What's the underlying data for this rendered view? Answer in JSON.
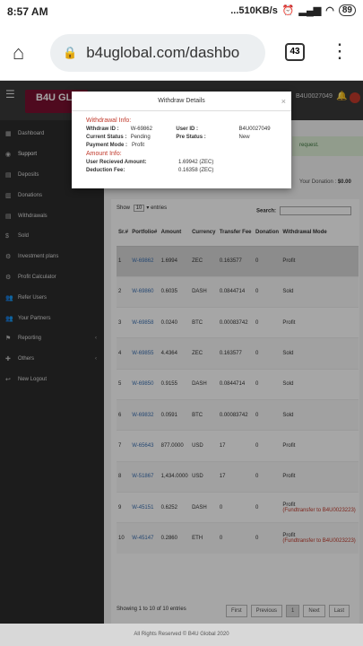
{
  "status": {
    "time": "8:57 AM",
    "speed": "...510KB/s",
    "battery": "89"
  },
  "browser": {
    "url": "b4uglobal.com/dashbo",
    "tabs": "43"
  },
  "brand": {
    "logo": "B4U GL",
    "user": "B4U0027049"
  },
  "sidebar": [
    "Dashboard",
    "Support",
    "Deposits",
    "Donations",
    "Withdrawals",
    "Sold",
    "Investment plans",
    "Profit Calculator",
    "Refer Users",
    "Your Partners",
    "Reporting",
    "Others",
    "New Logout"
  ],
  "sidebar_icons": [
    "dashboard-icon",
    "support-icon",
    "deposits-icon",
    "donations-icon",
    "withdrawals-icon",
    "sold-icon",
    "plans-icon",
    "calculator-icon",
    "refer-icon",
    "partners-icon",
    "reporting-icon",
    "others-icon",
    "logout-icon"
  ],
  "alert": "request.",
  "donation": {
    "label": "Your Donation :",
    "value": "$0.00"
  },
  "table": {
    "show_pre": "Show",
    "show_val": "10",
    "show_post": "entries",
    "search": "Search:",
    "headers": [
      "Sr.#",
      "Portfolio#",
      "Amount",
      "Currency",
      "Transfer Fee",
      "Donation",
      "Withdrawal Mode"
    ],
    "rows": [
      [
        "1",
        "W-69862",
        "1.6994",
        "ZEC",
        "0.163577",
        "0",
        "Profit",
        ""
      ],
      [
        "2",
        "W-69860",
        "0.6035",
        "DASH",
        "0.0844714",
        "0",
        "Sold",
        ""
      ],
      [
        "3",
        "W-69858",
        "0.0240",
        "BTC",
        "0.00083742",
        "0",
        "Profit",
        ""
      ],
      [
        "4",
        "W-69855",
        "4.4364",
        "ZEC",
        "0.163577",
        "0",
        "Sold",
        ""
      ],
      [
        "5",
        "W-69850",
        "0.9155",
        "DASH",
        "0.0844714",
        "0",
        "Sold",
        ""
      ],
      [
        "6",
        "W-69832",
        "0.0591",
        "BTC",
        "0.00083742",
        "0",
        "Sold",
        ""
      ],
      [
        "7",
        "W-65643",
        "877.0000",
        "USD",
        "17",
        "0",
        "Profit",
        ""
      ],
      [
        "8",
        "W-51867",
        "1,434.0000",
        "USD",
        "17",
        "0",
        "Profit",
        ""
      ],
      [
        "9",
        "W-45151",
        "0.6252",
        "DASH",
        "0",
        "0",
        "Profit",
        "(Fundtransfer to B4U0023223)"
      ],
      [
        "10",
        "W-45147",
        "0.2860",
        "ETH",
        "0",
        "0",
        "Profit",
        "(Fundtransfer to B4U0023223)"
      ]
    ],
    "footer": "Showing 1 to 10 of 10 entries",
    "pager": [
      "First",
      "Previous",
      "1",
      "Next",
      "Last"
    ]
  },
  "copyright": "All Rights Reserved © B4U Global 2020",
  "modal": {
    "title": "Withdraw Details",
    "close": "×",
    "sec1": "Withdrawal Info:",
    "wid_l": "Wthdraw ID :",
    "wid_v": "W-69862",
    "uid_l": "User ID :",
    "uid_v": "B4U0027049",
    "cs_l": "Current Status :",
    "cs_v": "Pending",
    "ps_l": "Pre Status :",
    "ps_v": "New",
    "pm_l": "Payment Mode :",
    "pm_v": "Profit",
    "sec2": "Amount Info:",
    "ura_l": "User Recieved Amount:",
    "ura_v": "1.69942 (ZEC)",
    "df_l": "Deduction Fee:",
    "df_v": "0.16358 (ZEC)"
  }
}
